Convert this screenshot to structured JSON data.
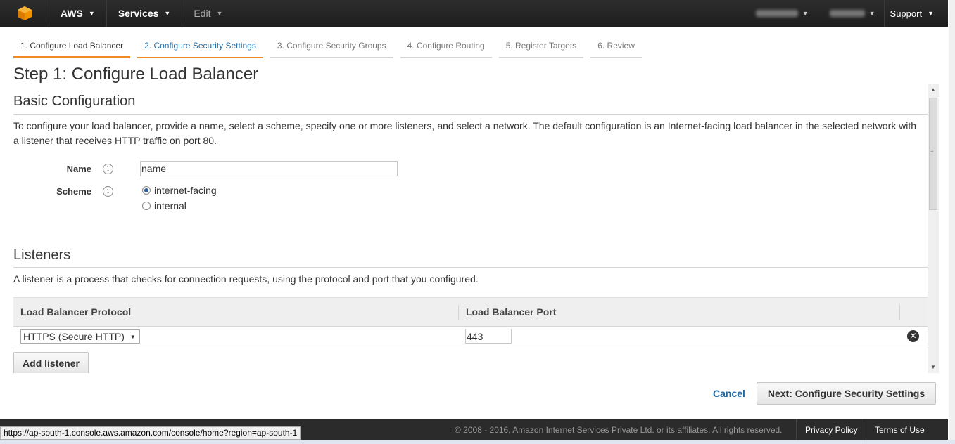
{
  "topnav": {
    "brand": "AWS",
    "services": "Services",
    "edit": "Edit",
    "user_blurred": "",
    "region_blurred": "",
    "support": "Support"
  },
  "wizard_tabs": [
    {
      "label": "1. Configure Load Balancer",
      "state": "active"
    },
    {
      "label": "2. Configure Security Settings",
      "state": "link"
    },
    {
      "label": "3. Configure Security Groups",
      "state": "disabled"
    },
    {
      "label": "4. Configure Routing",
      "state": "disabled"
    },
    {
      "label": "5. Register Targets",
      "state": "disabled"
    },
    {
      "label": "6. Review",
      "state": "disabled"
    }
  ],
  "page": {
    "step_title": "Step 1: Configure Load Balancer"
  },
  "basic": {
    "title": "Basic Configuration",
    "description": "To configure your load balancer, provide a name, select a scheme, specify one or more listeners, and select a network. The default configuration is an Internet-facing load balancer in the selected network with a listener that receives HTTP traffic on port 80.",
    "name_label": "Name",
    "name_value": "name",
    "scheme_label": "Scheme",
    "scheme_options": [
      "internet-facing",
      "internal"
    ],
    "scheme_selected": "internet-facing"
  },
  "listeners": {
    "title": "Listeners",
    "description": "A listener is a process that checks for connection requests, using the protocol and port that you configured.",
    "columns": [
      "Load Balancer Protocol",
      "Load Balancer Port"
    ],
    "rows": [
      {
        "protocol": "HTTPS (Secure HTTP)",
        "port": "443"
      }
    ],
    "add_button": "Add listener"
  },
  "actions": {
    "cancel": "Cancel",
    "next": "Next: Configure Security Settings"
  },
  "footer": {
    "copyright": "© 2008 - 2016, Amazon Internet Services Private Ltd. or its affiliates. All rights reserved.",
    "privacy": "Privacy Policy",
    "terms": "Terms of Use"
  },
  "status_url": "https://ap-south-1.console.aws.amazon.com/console/home?region=ap-south-1",
  "colors": {
    "accent_orange": "#f08a24",
    "link_blue": "#1f6aa5",
    "nav_bg": "#232323"
  }
}
